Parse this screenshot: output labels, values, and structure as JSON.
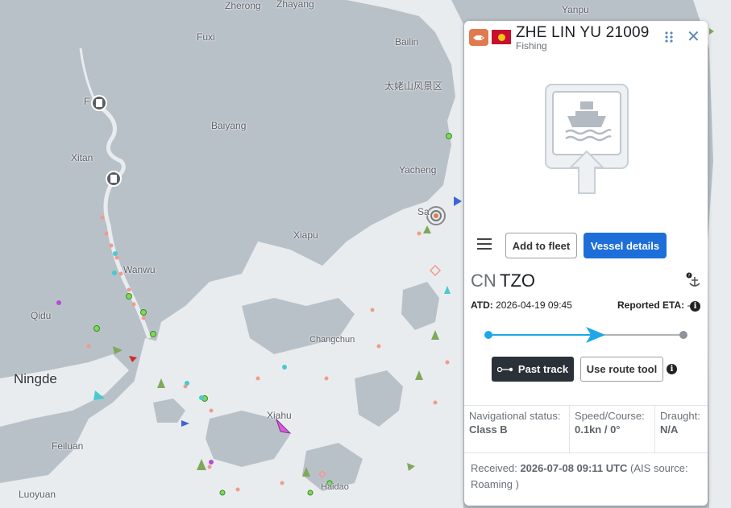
{
  "map": {
    "places": [
      {
        "name": "Zherong",
        "big": false
      },
      {
        "name": "Zhayang",
        "big": false
      },
      {
        "name": "Fuxi",
        "big": false
      },
      {
        "name": "Bailin",
        "big": false
      },
      {
        "name": "太姥山风景区",
        "big": false
      },
      {
        "name": "Baiyang",
        "big": false
      },
      {
        "name": "Xitan",
        "big": false
      },
      {
        "name": "Yacheng",
        "big": false
      },
      {
        "name": "Xiapu",
        "big": false
      },
      {
        "name": "Wanwu",
        "big": false
      },
      {
        "name": "Qidu",
        "big": false
      },
      {
        "name": "Changchun",
        "big": false
      },
      {
        "name": "Ningde",
        "big": true
      },
      {
        "name": "Xiahu",
        "big": false
      },
      {
        "name": "Feiluan",
        "big": false
      },
      {
        "name": "Haidao",
        "big": false
      },
      {
        "name": "Luoyuan",
        "big": false
      },
      {
        "name": "Yanpu",
        "big": false
      },
      {
        "name": "F",
        "big": false
      },
      {
        "name": "Sa",
        "big": false
      }
    ]
  },
  "panel": {
    "vessel_name": "ZHE LIN YU 21009",
    "vessel_type": "Fishing",
    "type_icon": "fishing-vessel-icon",
    "flag_icon": "flag-icon",
    "add_fleet_label": "Add to fleet",
    "details_label": "Vessel details",
    "route_from": "CN",
    "route_to": "TZO",
    "atd_label": "ATD:",
    "atd_value": "2026-04-19 09:45",
    "eta_label": "Reported ETA:",
    "eta_value": "-",
    "progress_fraction": 0.55,
    "past_track_label": "Past track",
    "route_tool_label": "Use route tool",
    "nav_status_label": "Navigational status:",
    "nav_status_value": "Class B",
    "speed_label": "Speed/Course:",
    "speed_value": "0.1kn / 0°",
    "draught_label": "Draught:",
    "draught_value": "N/A",
    "received_label": "Received:",
    "received_value": "2026-07-08 09:11 UTC",
    "received_suffix": "(AIS source: Roaming )"
  },
  "colors": {
    "accent": "#1e6ed9",
    "track_line": "#1ea7e8",
    "dark_button": "#2b3138",
    "land": "#b9c1c8",
    "water": "#e9ecef"
  }
}
